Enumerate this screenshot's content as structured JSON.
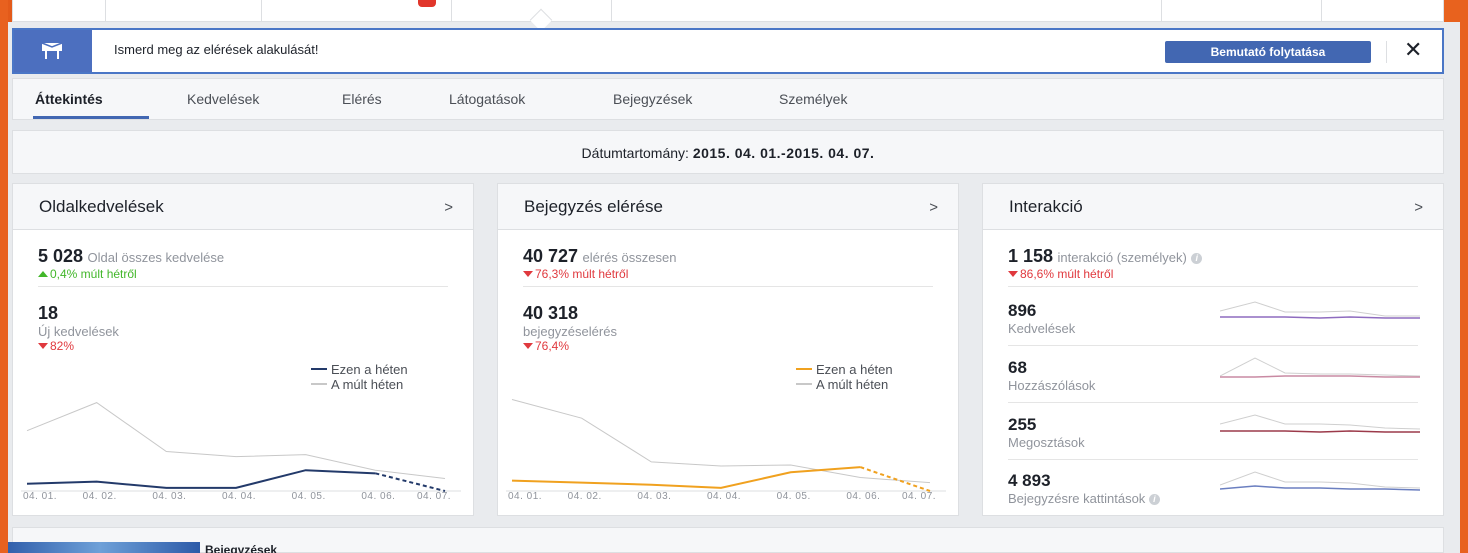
{
  "banner": {
    "message": "Ismerd meg az elérések alakulását!",
    "cta_label": "Bemutató folytatása",
    "close_glyph": "✕",
    "icon": "pin-flag-icon"
  },
  "tabs": [
    "Áttekintés",
    "Kedvelések",
    "Elérés",
    "Látogatások",
    "Bejegyzések",
    "Személyek"
  ],
  "active_tab": "Áttekintés",
  "daterange": {
    "label": "Dátumtartomány:",
    "value": "2015. 04. 01.-2015. 04. 07."
  },
  "colors": {
    "accent": "#4267b2",
    "this_week_likes": "#233a6a",
    "this_week_reach": "#f0a11f",
    "last_week": "#c8c8c8",
    "up": "#42b72a",
    "down": "#e0393e",
    "frame": "#e8611f"
  },
  "cards": {
    "likes": {
      "title": "Oldalkedvelések",
      "arrow": ">",
      "total": "5 028",
      "total_label": "Oldal összes kedvelése",
      "total_change": "0,4% múlt hétről",
      "new_value": "18",
      "new_label": "Új kedvelések",
      "new_change": "82%",
      "legend_this": "Ezen a héten",
      "legend_last": "A múlt héten"
    },
    "reach": {
      "title": "Bejegyzés elérése",
      "arrow": ">",
      "total": "40 727",
      "total_label": "elérés összesen",
      "total_change": "76,3% múlt hétről",
      "post_value": "40 318",
      "post_label": "bejegyzéselérés",
      "post_change": "76,4%",
      "legend_this": "Ezen a héten",
      "legend_last": "A múlt héten"
    },
    "interaction": {
      "title": "Interakció",
      "arrow": ">",
      "total": "1 158",
      "total_label": "interakció (személyek)",
      "total_change": "86,6% múlt hétről",
      "rows": [
        {
          "value": "896",
          "label": "Kedvelések"
        },
        {
          "value": "68",
          "label": "Hozzászólások"
        },
        {
          "value": "255",
          "label": "Megosztások"
        },
        {
          "value": "4 893",
          "label": "Bejegyzésre kattintások"
        }
      ]
    }
  },
  "chart_data": [
    {
      "type": "line",
      "categories": [
        "04. 01.",
        "04. 02.",
        "04. 03.",
        "04. 04.",
        "04. 05.",
        "04. 06.",
        "04. 07."
      ],
      "series": [
        {
          "name": "Ezen a héten",
          "values": [
            7,
            9,
            3,
            3,
            20,
            17,
            0
          ]
        },
        {
          "name": "A múlt héten",
          "values": [
            58,
            85,
            38,
            33,
            35,
            20,
            12
          ]
        }
      ],
      "ylim": [
        0,
        100
      ]
    },
    {
      "type": "line",
      "categories": [
        "04. 01.",
        "04. 02.",
        "04. 03.",
        "04. 04.",
        "04. 05.",
        "04. 06.",
        "04. 07."
      ],
      "series": [
        {
          "name": "Ezen a héten",
          "values": [
            10,
            8,
            6,
            3,
            18,
            23,
            0
          ]
        },
        {
          "name": "A múlt héten",
          "values": [
            88,
            70,
            28,
            24,
            25,
            13,
            8
          ]
        }
      ],
      "ylim": [
        0,
        100
      ]
    }
  ],
  "bottom": {
    "text": "Bejegyzések"
  }
}
